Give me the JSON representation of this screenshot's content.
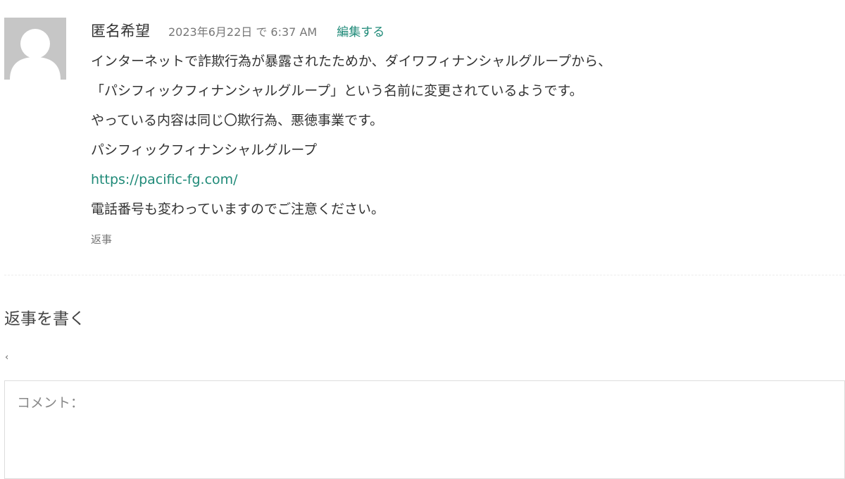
{
  "comment": {
    "author": "匿名希望",
    "date": "2023年6月22日 で 6:37 AM",
    "edit_label": "編集する",
    "lines": [
      "インターネットで詐欺行為が暴露されたためか、ダイワフィナンシャルグループから、",
      "「パシフィックフィナンシャルグループ」という名前に変更されているようです。",
      "やっている内容は同じ〇欺行為、悪徳事業です。",
      "パシフィックフィナンシャルグループ"
    ],
    "url": "https://pacific-fg.com/",
    "last_line": "電話番号も変わっていますのでご注意ください。",
    "reply_label": "返事"
  },
  "reply_form": {
    "title": "返事を書く",
    "small_mark": "‹",
    "comment_placeholder": "コメント："
  },
  "colors": {
    "link": "#1f8a78",
    "avatar_bg": "#c6c6c6",
    "text": "#333333",
    "muted": "#777777"
  },
  "icons": {
    "avatar": "default-user-avatar-icon"
  }
}
